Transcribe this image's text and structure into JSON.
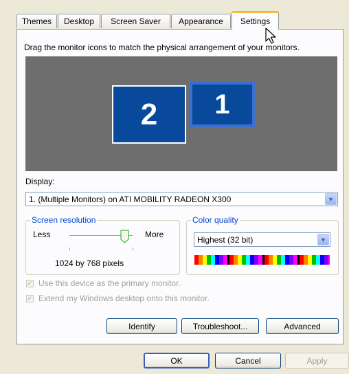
{
  "tabs": [
    "Themes",
    "Desktop",
    "Screen Saver",
    "Appearance",
    "Settings"
  ],
  "instructions": "Drag the monitor icons to match the physical arrangement of your monitors.",
  "monitors": {
    "primary_label": "1",
    "secondary_label": "2"
  },
  "display": {
    "label": "Display:",
    "value": "1. (Multiple Monitors) on ATI MOBILITY RADEON X300"
  },
  "resolution": {
    "group_label": "Screen resolution",
    "less": "Less",
    "more": "More",
    "value_text": "1024 by 768 pixels",
    "slider_position": 0.88
  },
  "color_quality": {
    "group_label": "Color quality",
    "value": "Highest (32 bit)"
  },
  "checkboxes": [
    {
      "label": "Use this device as the primary monitor.",
      "checked": true,
      "enabled": false
    },
    {
      "label": "Extend my Windows desktop onto this monitor.",
      "checked": true,
      "enabled": false
    }
  ],
  "buttons": {
    "identify": "Identify",
    "troubleshoot": "Troubleshoot...",
    "advanced": "Advanced",
    "ok": "OK",
    "cancel": "Cancel",
    "apply": "Apply"
  },
  "colors": {
    "monitor_fill": "#08499b",
    "monitor_area": "#6e6e6e",
    "group_label": "#0046d5",
    "dialog_bg": "#ece9d8"
  }
}
